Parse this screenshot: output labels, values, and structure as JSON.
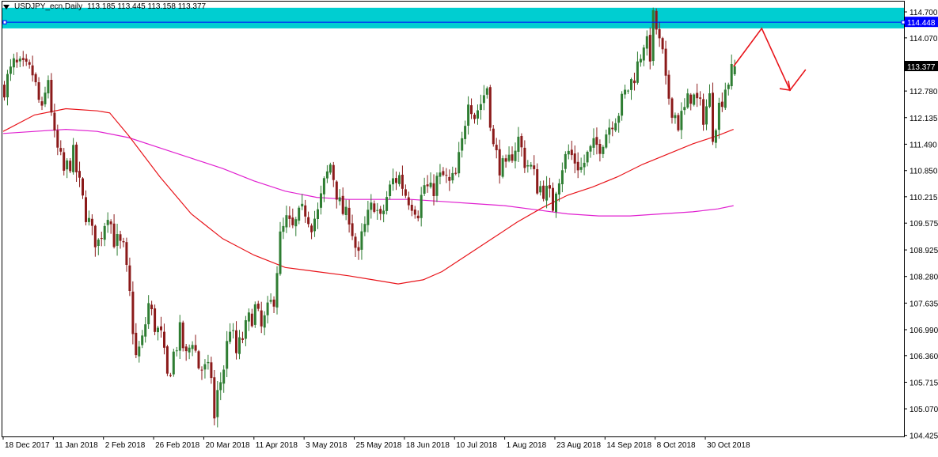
{
  "header": {
    "symbol": "USDJPY_ecn,Daily",
    "ohlc": "113.185 113.445 113.158 113.377"
  },
  "colors": {
    "zone": "#00CED1",
    "level_line": "#0000FF",
    "candle_up": "#2E7D32",
    "candle_down": "#8B1A1A",
    "ma_fast": "#E8141A",
    "ma_slow": "#E020D0",
    "arrow": "#E8141A",
    "price_tag_bg": "#000000",
    "level_tag_bg": "#0000FF"
  },
  "chart_data": {
    "type": "candlestick",
    "title": "USDJPY_ecn,Daily",
    "price_axis": {
      "ticks": [
        114.7,
        114.07,
        113.425,
        112.78,
        112.135,
        111.49,
        110.85,
        110.215,
        109.575,
        108.925,
        108.28,
        107.635,
        106.99,
        106.36,
        105.715,
        105.07,
        104.425
      ],
      "ylim": [
        104.4,
        114.95
      ]
    },
    "time_axis": {
      "labels": [
        "18 Dec 2017",
        "11 Jan 2018",
        "2 Feb 2018",
        "26 Feb 2018",
        "20 Mar 2018",
        "11 Apr 2018",
        "3 May 2018",
        "25 May 2018",
        "18 Jun 2018",
        "10 Jul 2018",
        "1 Aug 2018",
        "23 Aug 2018",
        "14 Sep 2018",
        "8 Oct 2018",
        "30 Oct 2018"
      ],
      "label_bar_index": [
        0,
        16,
        32,
        48,
        64,
        80,
        96,
        112,
        128,
        144,
        160,
        176,
        192,
        208,
        224
      ],
      "bar_count": 230
    },
    "zone": {
      "low": 114.3,
      "high": 114.8
    },
    "level_line": {
      "value": 114.448,
      "label": "114.448"
    },
    "current_price": {
      "value": 113.377,
      "label": "113.377"
    },
    "price_anchors": [
      [
        0,
        112.9
      ],
      [
        3,
        113.4
      ],
      [
        6,
        113.3
      ],
      [
        9,
        113.2
      ],
      [
        12,
        112.2
      ],
      [
        14,
        113.1
      ],
      [
        16,
        111.6
      ],
      [
        19,
        110.8
      ],
      [
        22,
        111.2
      ],
      [
        25,
        110.1
      ],
      [
        28,
        109.3
      ],
      [
        30,
        109.1
      ],
      [
        33,
        109.9
      ],
      [
        35,
        109.2
      ],
      [
        38,
        108.9
      ],
      [
        40,
        107.8
      ],
      [
        42,
        106.3
      ],
      [
        44,
        106.7
      ],
      [
        46,
        107.6
      ],
      [
        48,
        107.1
      ],
      [
        50,
        106.8
      ],
      [
        52,
        105.8
      ],
      [
        54,
        106.4
      ],
      [
        56,
        106.9
      ],
      [
        58,
        106.3
      ],
      [
        60,
        106.8
      ],
      [
        62,
        106.1
      ],
      [
        64,
        106.0
      ],
      [
        66,
        105.9
      ],
      [
        67,
        104.8
      ],
      [
        68,
        105.4
      ],
      [
        70,
        106.1
      ],
      [
        72,
        107.1
      ],
      [
        74,
        106.4
      ],
      [
        76,
        106.8
      ],
      [
        78,
        107.2
      ],
      [
        80,
        107.5
      ],
      [
        82,
        107.0
      ],
      [
        84,
        107.4
      ],
      [
        86,
        107.8
      ],
      [
        88,
        109.2
      ],
      [
        90,
        109.6
      ],
      [
        92,
        109.4
      ],
      [
        94,
        109.7
      ],
      [
        96,
        109.9
      ],
      [
        98,
        109.6
      ],
      [
        100,
        109.8
      ],
      [
        102,
        110.5
      ],
      [
        104,
        111.0
      ],
      [
        105,
        110.7
      ],
      [
        107,
        110.0
      ],
      [
        109,
        109.7
      ],
      [
        110,
        109.8
      ],
      [
        112,
        109.0
      ],
      [
        113,
        108.7
      ],
      [
        114,
        109.2
      ],
      [
        116,
        109.7
      ],
      [
        118,
        110.1
      ],
      [
        120,
        109.6
      ],
      [
        122,
        110.2
      ],
      [
        124,
        110.6
      ],
      [
        126,
        110.7
      ],
      [
        128,
        110.3
      ],
      [
        130,
        110.1
      ],
      [
        132,
        109.9
      ],
      [
        134,
        110.5
      ],
      [
        136,
        110.3
      ],
      [
        138,
        110.6
      ],
      [
        140,
        110.7
      ],
      [
        142,
        110.5
      ],
      [
        144,
        110.7
      ],
      [
        146,
        111.5
      ],
      [
        148,
        112.7
      ],
      [
        150,
        112.2
      ],
      [
        152,
        112.5
      ],
      [
        154,
        112.9
      ],
      [
        156,
        111.4
      ],
      [
        158,
        111.0
      ],
      [
        160,
        110.8
      ],
      [
        162,
        111.3
      ],
      [
        164,
        111.6
      ],
      [
        166,
        111.1
      ],
      [
        168,
        110.9
      ],
      [
        170,
        110.5
      ],
      [
        172,
        110.4
      ],
      [
        174,
        110.2
      ],
      [
        175,
        110.0
      ],
      [
        176,
        110.5
      ],
      [
        178,
        111.0
      ],
      [
        180,
        111.3
      ],
      [
        182,
        111.1
      ],
      [
        184,
        110.9
      ],
      [
        186,
        111.2
      ],
      [
        188,
        111.4
      ],
      [
        190,
        111.5
      ],
      [
        192,
        111.8
      ],
      [
        194,
        112.1
      ],
      [
        196,
        112.3
      ],
      [
        198,
        112.7
      ],
      [
        200,
        113.0
      ],
      [
        202,
        113.4
      ],
      [
        204,
        114.0
      ],
      [
        206,
        113.7
      ],
      [
        207,
        114.5
      ],
      [
        208,
        114.3
      ],
      [
        209,
        113.9
      ],
      [
        210,
        113.6
      ],
      [
        211,
        112.9
      ],
      [
        213,
        112.4
      ],
      [
        215,
        112.0
      ],
      [
        217,
        112.3
      ],
      [
        219,
        112.7
      ],
      [
        221,
        112.5
      ],
      [
        223,
        112.2
      ],
      [
        225,
        112.6
      ],
      [
        226,
        111.8
      ],
      [
        228,
        112.4
      ],
      [
        230,
        112.9
      ],
      [
        232,
        113.2
      ],
      [
        233,
        113.377
      ]
    ],
    "ma_fast": [
      [
        0,
        111.8
      ],
      [
        10,
        112.2
      ],
      [
        20,
        112.35
      ],
      [
        30,
        112.3
      ],
      [
        34,
        112.25
      ],
      [
        40,
        111.7
      ],
      [
        50,
        110.7
      ],
      [
        60,
        109.8
      ],
      [
        70,
        109.2
      ],
      [
        80,
        108.8
      ],
      [
        90,
        108.5
      ],
      [
        100,
        108.4
      ],
      [
        110,
        108.3
      ],
      [
        118,
        108.2
      ],
      [
        126,
        108.1
      ],
      [
        134,
        108.2
      ],
      [
        140,
        108.4
      ],
      [
        148,
        108.8
      ],
      [
        156,
        109.2
      ],
      [
        164,
        109.6
      ],
      [
        172,
        109.95
      ],
      [
        180,
        110.25
      ],
      [
        188,
        110.45
      ],
      [
        196,
        110.7
      ],
      [
        204,
        111.0
      ],
      [
        212,
        111.25
      ],
      [
        220,
        111.5
      ],
      [
        228,
        111.7
      ],
      [
        233,
        111.85
      ]
    ],
    "ma_slow": [
      [
        0,
        111.75
      ],
      [
        10,
        111.8
      ],
      [
        20,
        111.85
      ],
      [
        30,
        111.8
      ],
      [
        40,
        111.65
      ],
      [
        50,
        111.4
      ],
      [
        60,
        111.15
      ],
      [
        70,
        110.9
      ],
      [
        80,
        110.6
      ],
      [
        90,
        110.35
      ],
      [
        100,
        110.2
      ],
      [
        110,
        110.15
      ],
      [
        120,
        110.15
      ],
      [
        130,
        110.15
      ],
      [
        140,
        110.1
      ],
      [
        150,
        110.05
      ],
      [
        160,
        110.0
      ],
      [
        170,
        109.9
      ],
      [
        180,
        109.8
      ],
      [
        190,
        109.75
      ],
      [
        200,
        109.75
      ],
      [
        210,
        109.8
      ],
      [
        220,
        109.85
      ],
      [
        228,
        109.92
      ],
      [
        233,
        110.0
      ]
    ],
    "forecast_arrow": [
      [
        233,
        113.377
      ],
      [
        242,
        114.3
      ],
      [
        251,
        112.8
      ],
      [
        256,
        113.3
      ]
    ],
    "grid": false
  }
}
